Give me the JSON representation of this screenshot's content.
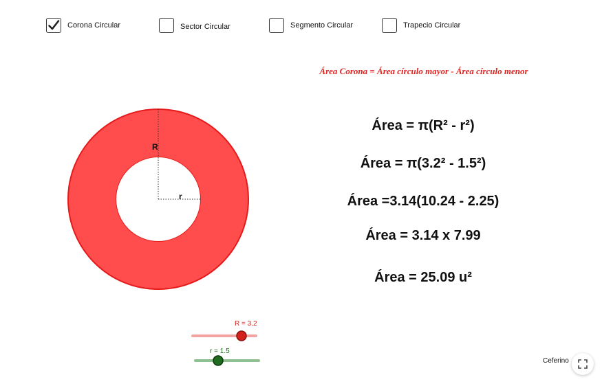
{
  "checkboxes": [
    {
      "label": "Corona Circular",
      "checked": true
    },
    {
      "label": "Sector Circular",
      "checked": false
    },
    {
      "label": "Segmento Circular",
      "checked": false
    },
    {
      "label": "Trapecio Circular",
      "checked": false
    }
  ],
  "formula_caption": "Área Corona = Área círculo mayor - Área círculo menor",
  "equations": [
    "Área = π(R² - r²)",
    "Área = π(3.2² - 1.5²)",
    "Área =3.14(10.24 - 2.25)",
    "Área = 3.14 x 7.99",
    "Área = 25.09 u²"
  ],
  "figure": {
    "outer_radius_label": "R",
    "inner_radius_label": "r",
    "fill_color": "#ff4d4d",
    "stroke_color": "#e61a1a"
  },
  "sliders": {
    "R": {
      "label": "R = 3.2",
      "value": 3.2,
      "color": "#d4201c",
      "track_color": "#f4a3a3"
    },
    "r": {
      "label": "r = 1.5",
      "value": 1.5,
      "color": "#1f6b1f",
      "track_color": "#8fc08f"
    }
  },
  "author": "Ceferino",
  "icons": {
    "checkmark": "checkmark-icon",
    "fullscreen": "fullscreen-icon"
  }
}
